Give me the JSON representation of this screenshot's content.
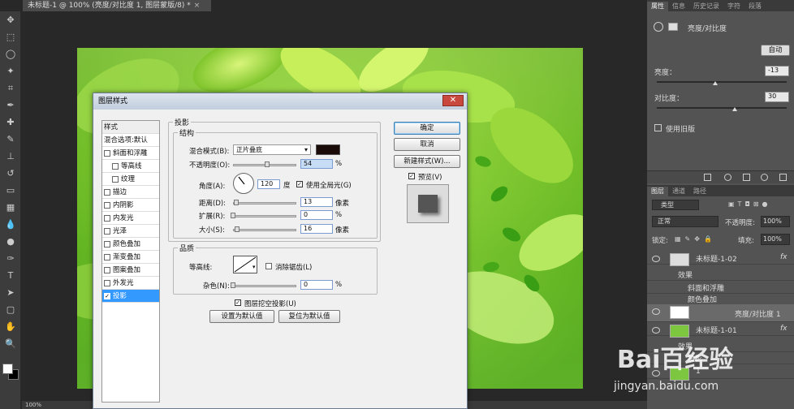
{
  "document": {
    "tab_title": "未标题-1 @ 100% (亮度/对比度 1, 图层蒙版/8) *",
    "tab_close": "×"
  },
  "status": {
    "zoom": "100%"
  },
  "tools": [
    "move-icon",
    "marquee-icon",
    "lasso-icon",
    "quick-select-icon",
    "crop-icon",
    "eyedropper-icon",
    "healing-icon",
    "brush-icon",
    "stamp-icon",
    "history-brush-icon",
    "eraser-icon",
    "gradient-icon",
    "blur-icon",
    "dodge-icon",
    "pen-icon",
    "type-icon",
    "path-select-icon",
    "shape-icon",
    "hand-icon",
    "zoom-icon"
  ],
  "properties": {
    "tabs": [
      "属性",
      "信息",
      "历史记录",
      "字符",
      "段落"
    ],
    "adj_title": "亮度/对比度",
    "auto_label": "自动",
    "brightness_label": "亮度：",
    "brightness_value": "-13",
    "brightness_pos": 0.45,
    "contrast_label": "对比度：",
    "contrast_value": "30",
    "contrast_pos": 0.6,
    "legacy_label": "使用旧版"
  },
  "layers": {
    "tabs": [
      "图层",
      "通道",
      "路径"
    ],
    "filter_label": "类型",
    "blend_mode": "正常",
    "opacity_label": "不透明度:",
    "opacity_value": "100%",
    "lock_label": "锁定:",
    "fill_label": "填充:",
    "fill_value": "100%",
    "items": [
      {
        "name": "未标题-1-02",
        "fx": "fx"
      },
      {
        "name": "效果"
      },
      {
        "name": "斜面和浮雕"
      },
      {
        "name": "颜色叠加"
      },
      {
        "name": "亮度/对比度 1"
      },
      {
        "name": "未标题-1-01",
        "fx": "fx"
      },
      {
        "name": "效果"
      },
      {
        "name": "投影"
      },
      {
        "name": "1"
      }
    ]
  },
  "dialog": {
    "title": "图层样式",
    "close": "✕",
    "styles_header": "样式",
    "blend_options": "混合选项:默认",
    "styles": [
      {
        "label": "斜面和浮雕",
        "checked": false,
        "sub": false
      },
      {
        "label": "等高线",
        "checked": false,
        "sub": true
      },
      {
        "label": "纹理",
        "checked": false,
        "sub": true
      },
      {
        "label": "描边",
        "checked": false,
        "sub": false
      },
      {
        "label": "内阴影",
        "checked": false,
        "sub": false
      },
      {
        "label": "内发光",
        "checked": false,
        "sub": false
      },
      {
        "label": "光泽",
        "checked": false,
        "sub": false
      },
      {
        "label": "颜色叠加",
        "checked": false,
        "sub": false
      },
      {
        "label": "渐变叠加",
        "checked": false,
        "sub": false
      },
      {
        "label": "图案叠加",
        "checked": false,
        "sub": false
      },
      {
        "label": "外发光",
        "checked": false,
        "sub": false
      },
      {
        "label": "投影",
        "checked": true,
        "sub": false,
        "selected": true
      }
    ],
    "section_title": "投影",
    "structure": {
      "title": "结构",
      "blend_label": "混合模式(B):",
      "blend_value": "正片叠底",
      "shadow_color": "#1a0a08",
      "opacity_label": "不透明度(O):",
      "opacity_value": "54",
      "opacity_pos": 0.54,
      "pct": "%",
      "angle_label": "角度(A):",
      "angle_value": "120",
      "degree": "度",
      "global_light_label": "使用全局光(G)",
      "distance_label": "距离(D):",
      "distance_value": "13",
      "distance_pos": 0.05,
      "spread_label": "扩展(R):",
      "spread_value": "0",
      "spread_pos": 0.0,
      "size_label": "大小(S):",
      "size_value": "16",
      "size_pos": 0.06,
      "px": "像素"
    },
    "quality": {
      "title": "品质",
      "contour_label": "等高线:",
      "antialias_label": "消除锯齿(L)",
      "noise_label": "杂色(N):",
      "noise_value": "0",
      "noise_pos": 0.0,
      "pct": "%"
    },
    "knockout_label": "图层挖空投影(U)",
    "default_button": "设置为默认值",
    "reset_button": "复位为默认值",
    "ok_button": "确定",
    "cancel_button": "取消",
    "new_style_button": "新建样式(W)...",
    "preview_label": "预览(V)"
  },
  "watermark": {
    "logo": "Bai百经验",
    "url": "jingyan.baidu.com"
  }
}
